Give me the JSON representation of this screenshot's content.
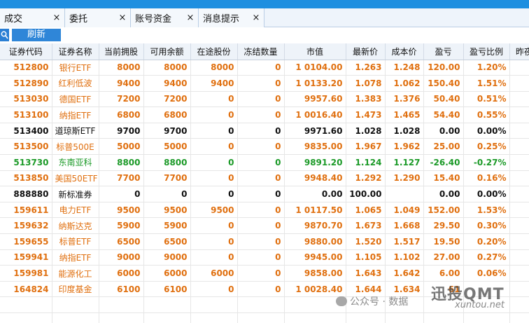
{
  "tabs": [
    {
      "label": "成交",
      "close": "×"
    },
    {
      "label": "委托",
      "close": "×"
    },
    {
      "label": "账号资金",
      "close": "×"
    },
    {
      "label": "消息提示",
      "close": "×"
    }
  ],
  "toolbar": {
    "search_icon": "search-icon",
    "refresh_label": "刷新"
  },
  "columns": [
    "证券代码",
    "证券名称",
    "当前拥股",
    "可用余额",
    "在途股份",
    "冻结数量",
    "市值",
    "最新价",
    "成本价",
    "盈亏",
    "盈亏比例",
    "昨夜"
  ],
  "rows": [
    {
      "code": "512800",
      "name": "银行ETF",
      "hold": "8000",
      "avail": "8000",
      "transit": "8000",
      "frozen": "0",
      "mv": "1 0104.00",
      "last": "1.263",
      "cost": "1.248",
      "pnl": "120.00",
      "pct": "1.20%",
      "tone": "orange"
    },
    {
      "code": "512890",
      "name": "红利低波",
      "hold": "9400",
      "avail": "9400",
      "transit": "9400",
      "frozen": "0",
      "mv": "1 0133.20",
      "last": "1.078",
      "cost": "1.062",
      "pnl": "150.40",
      "pct": "1.51%",
      "tone": "orange"
    },
    {
      "code": "513030",
      "name": "德国ETF",
      "hold": "7200",
      "avail": "7200",
      "transit": "0",
      "frozen": "0",
      "mv": "9957.60",
      "last": "1.383",
      "cost": "1.376",
      "pnl": "50.40",
      "pct": "0.51%",
      "tone": "orange"
    },
    {
      "code": "513100",
      "name": "纳指ETF",
      "hold": "6800",
      "avail": "6800",
      "transit": "0",
      "frozen": "0",
      "mv": "1 0016.40",
      "last": "1.473",
      "cost": "1.465",
      "pnl": "54.40",
      "pct": "0.55%",
      "tone": "orange"
    },
    {
      "code": "513400",
      "name": "道琼斯ETF",
      "hold": "9700",
      "avail": "9700",
      "transit": "0",
      "frozen": "0",
      "mv": "9971.60",
      "last": "1.028",
      "cost": "1.028",
      "pnl": "0.00",
      "pct": "0.00%",
      "tone": "black"
    },
    {
      "code": "513500",
      "name": "标普500E",
      "hold": "5000",
      "avail": "5000",
      "transit": "0",
      "frozen": "0",
      "mv": "9835.00",
      "last": "1.967",
      "cost": "1.962",
      "pnl": "25.00",
      "pct": "0.25%",
      "tone": "orange"
    },
    {
      "code": "513730",
      "name": "东南亚科",
      "hold": "8800",
      "avail": "8800",
      "transit": "0",
      "frozen": "0",
      "mv": "9891.20",
      "last": "1.124",
      "cost": "1.127",
      "pnl": "-26.40",
      "pct": "-0.27%",
      "tone": "green"
    },
    {
      "code": "513850",
      "name": "美国50ETF",
      "hold": "7700",
      "avail": "7700",
      "transit": "0",
      "frozen": "0",
      "mv": "9948.40",
      "last": "1.292",
      "cost": "1.290",
      "pnl": "15.40",
      "pct": "0.16%",
      "tone": "orange"
    },
    {
      "code": "888880",
      "name": "新标准券",
      "hold": "0",
      "avail": "0",
      "transit": "0",
      "frozen": "0",
      "mv": "0.00",
      "last": "100.00",
      "cost": "",
      "pnl": "0.00",
      "pct": "0.00%",
      "tone": "black"
    },
    {
      "code": "159611",
      "name": "电力ETF",
      "hold": "9500",
      "avail": "9500",
      "transit": "9500",
      "frozen": "0",
      "mv": "1 0117.50",
      "last": "1.065",
      "cost": "1.049",
      "pnl": "152.00",
      "pct": "1.53%",
      "tone": "orange"
    },
    {
      "code": "159632",
      "name": "纳斯达克",
      "hold": "5900",
      "avail": "5900",
      "transit": "0",
      "frozen": "0",
      "mv": "9870.70",
      "last": "1.673",
      "cost": "1.668",
      "pnl": "29.50",
      "pct": "0.30%",
      "tone": "orange"
    },
    {
      "code": "159655",
      "name": "标普ETF",
      "hold": "6500",
      "avail": "6500",
      "transit": "0",
      "frozen": "0",
      "mv": "9880.00",
      "last": "1.520",
      "cost": "1.517",
      "pnl": "19.50",
      "pct": "0.20%",
      "tone": "orange"
    },
    {
      "code": "159941",
      "name": "纳指ETF",
      "hold": "9000",
      "avail": "9000",
      "transit": "0",
      "frozen": "0",
      "mv": "9945.00",
      "last": "1.105",
      "cost": "1.102",
      "pnl": "27.00",
      "pct": "0.27%",
      "tone": "orange"
    },
    {
      "code": "159981",
      "name": "能源化工",
      "hold": "6000",
      "avail": "6000",
      "transit": "6000",
      "frozen": "0",
      "mv": "9858.00",
      "last": "1.643",
      "cost": "1.642",
      "pnl": "6.00",
      "pct": "0.06%",
      "tone": "orange"
    },
    {
      "code": "164824",
      "name": "印度基金",
      "hold": "6100",
      "avail": "6100",
      "transit": "0",
      "frozen": "0",
      "mv": "1 0028.40",
      "last": "1.644",
      "cost": "1.634",
      "pnl": "61",
      "pct": "",
      "tone": "orange"
    }
  ],
  "watermark": {
    "wechat": "公众号 · 数据",
    "brand": "迅投QMT",
    "site": "xuntou.net"
  },
  "colors": {
    "accent": "#1e8fe0",
    "up": "#e07010",
    "down": "#1c9a28",
    "flat": "#111111"
  }
}
